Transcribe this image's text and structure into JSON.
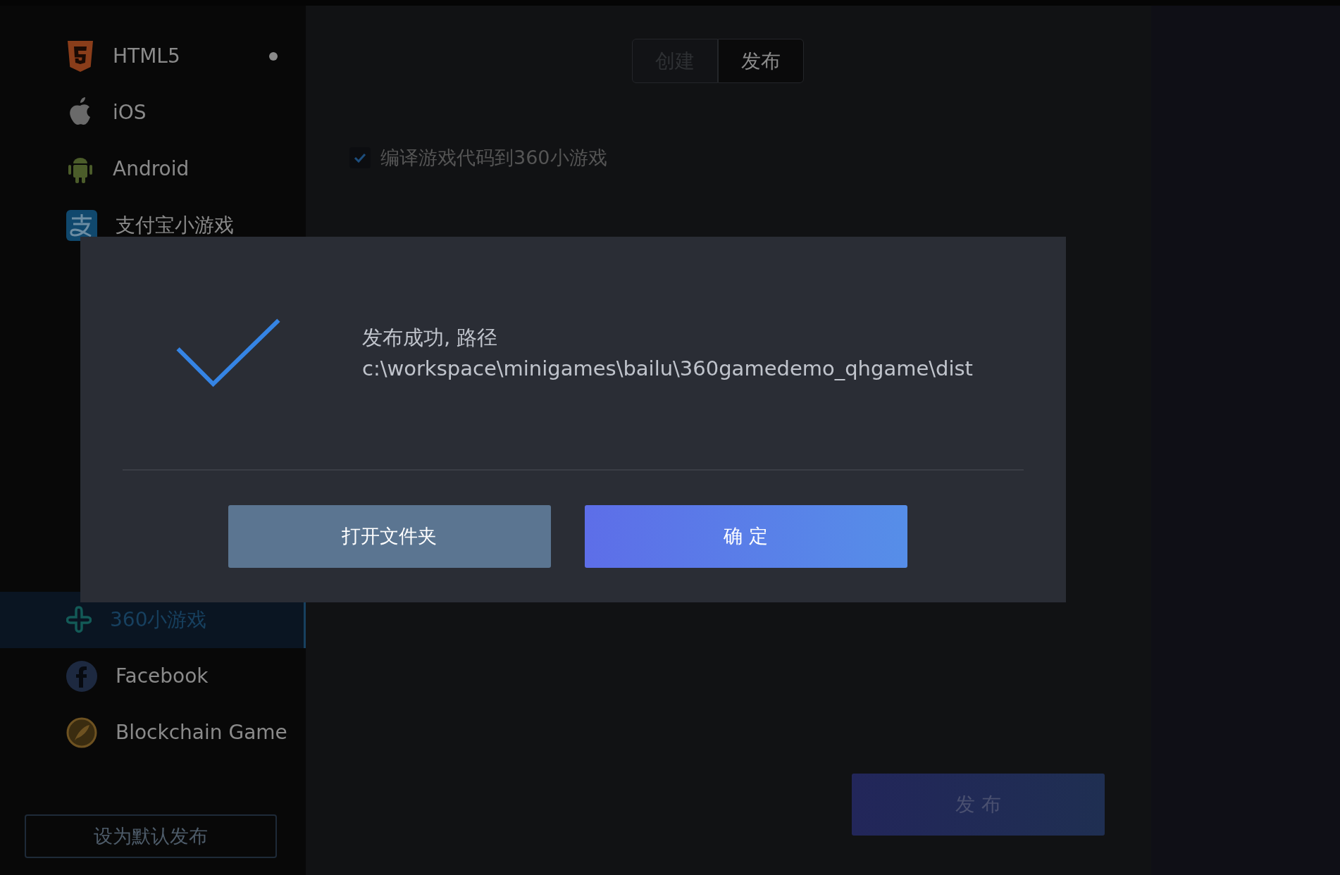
{
  "sidebar": {
    "items": [
      {
        "label": "HTML5",
        "selected": false,
        "is_default": true
      },
      {
        "label": "iOS",
        "selected": false,
        "is_default": false
      },
      {
        "label": "Android",
        "selected": false,
        "is_default": false
      },
      {
        "label": "支付宝小游戏",
        "selected": false,
        "is_default": false
      },
      {
        "label": "360小游戏",
        "selected": true,
        "is_default": false
      },
      {
        "label": "Facebook",
        "selected": false,
        "is_default": false
      },
      {
        "label": "Blockchain Game",
        "selected": false,
        "is_default": false
      }
    ],
    "default_button": "设为默认发布"
  },
  "tabs": [
    {
      "label": "创建",
      "selected": false
    },
    {
      "label": "发布",
      "selected": true
    }
  ],
  "options": [
    {
      "label": "编译游戏代码到360小游戏",
      "checked": true
    }
  ],
  "publish_button": "发 布",
  "dialog": {
    "message": "发布成功, 路径",
    "path": "c:\\workspace\\minigames\\bailu\\360gamedemo_qhgame\\dist",
    "buttons": [
      {
        "label": "打开文件夹",
        "kind": "secondary"
      },
      {
        "label": "确 定",
        "kind": "primary"
      }
    ]
  }
}
